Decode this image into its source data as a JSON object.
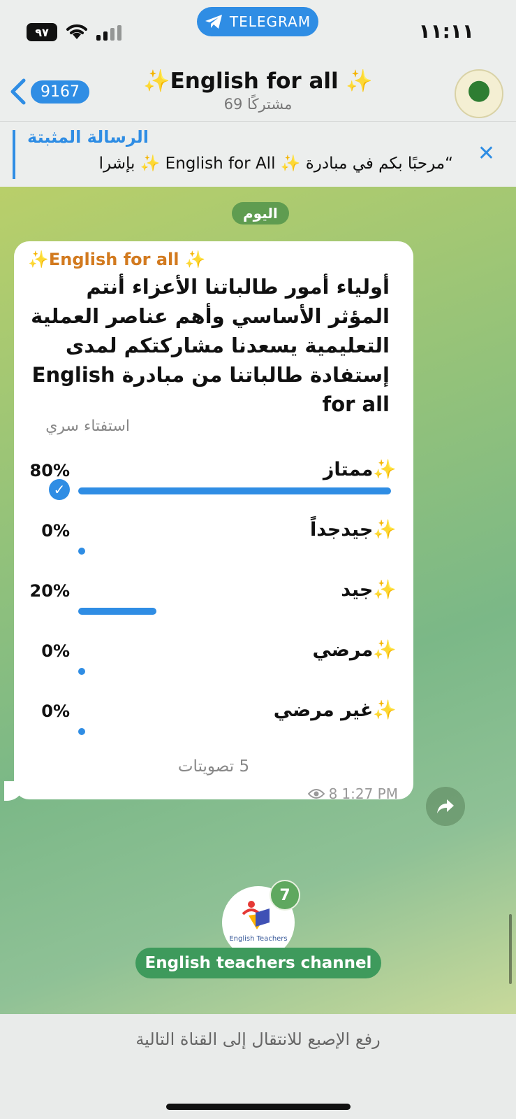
{
  "status_bar": {
    "battery": "٩٧",
    "badge": "TELEGRAM",
    "clock": "١١:١١"
  },
  "header": {
    "back_count": "9167",
    "title": "✨English for all ✨",
    "subtitle": "69 مشتركًا"
  },
  "pinned": {
    "title": "الرسالة المثبتة",
    "text": "“مرحبًا بكم في مبادرة ✨ English for All ✨ بإشرا"
  },
  "chat": {
    "date_chip": "اليوم",
    "poll": {
      "author": "✨English for all ✨",
      "question": "أولياء أمور طالباتنا الأعزاء أنتم المؤثر الأساسي وأهم عناصر العملية التعليمية يسعدنا مشاركتكم لمدى إستفادة طالباتنا من مبادرة English for all",
      "type": "استفتاء سري",
      "options": [
        {
          "label": "✨ممتاز",
          "percent": "80%",
          "value": 0.8,
          "chosen": true
        },
        {
          "label": "✨جيدجداً",
          "percent": "0%",
          "value": 0.0,
          "chosen": false
        },
        {
          "label": "✨جيد",
          "percent": "20%",
          "value": 0.2,
          "chosen": false
        },
        {
          "label": "✨مرضي",
          "percent": "0%",
          "value": 0.0,
          "chosen": false
        },
        {
          "label": "✨غير مرضي",
          "percent": "0%",
          "value": 0.0,
          "chosen": false
        }
      ],
      "votes": "5 تصويتات",
      "views": "8",
      "time": "1:27 PM"
    },
    "next_channel": {
      "name": "English teachers channel",
      "unread": "7",
      "logo_text": "English Teachers"
    }
  },
  "bottom": {
    "hint": "رفع الإصبع للانتقال إلى القناة التالية"
  },
  "colors": {
    "accent": "#2f8de4",
    "author": "#d27a1f",
    "channel_pill": "#3e9a5c"
  }
}
